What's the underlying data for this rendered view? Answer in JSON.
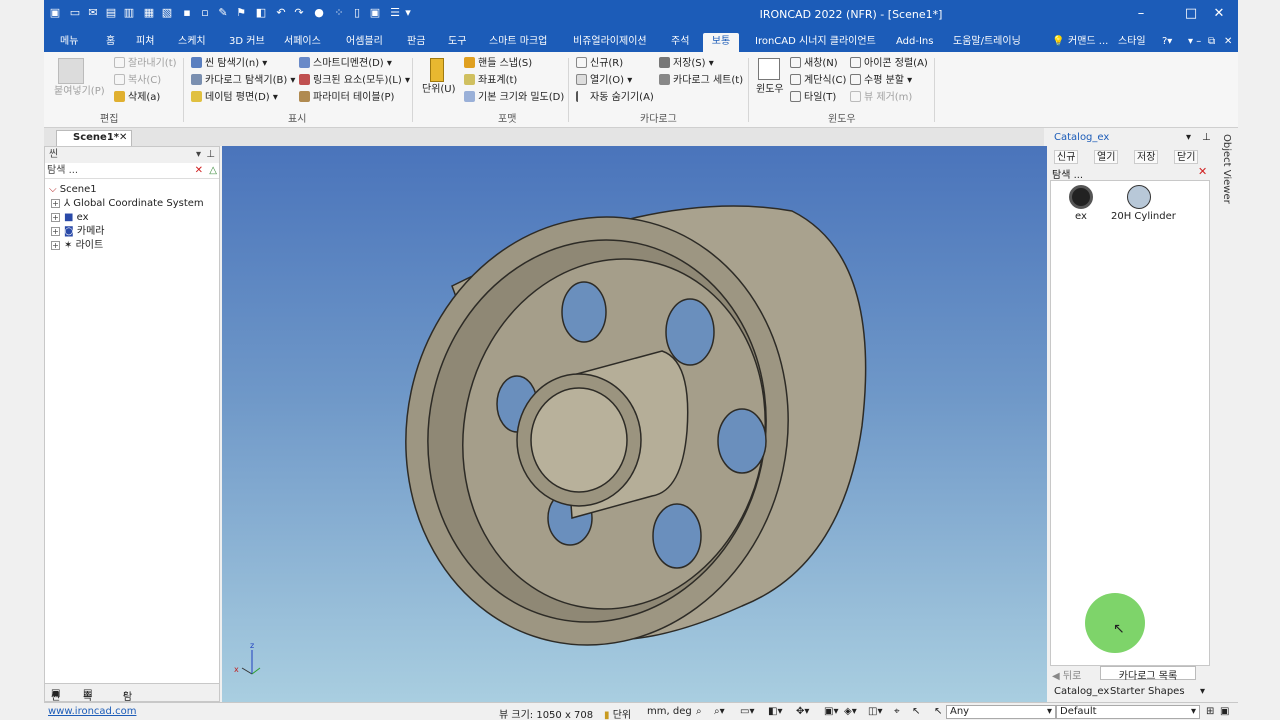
{
  "app": {
    "title": "IRONCAD 2022 (NFR) - [Scene1*]"
  },
  "ribbon_tabs": [
    "메뉴",
    "홈",
    "피쳐",
    "스케치",
    "3D 커브",
    "서페이스",
    "어셈블리",
    "판금",
    "도구",
    "스마트 마크업",
    "비쥬얼라이제이션",
    "주석",
    "보통",
    "IronCAD 시너지 클라이언트",
    "Add-Ins",
    "도움말/트레이닝"
  ],
  "active_tab": "보통",
  "tabs_right": {
    "command": "커맨드 ...",
    "style": "스타일"
  },
  "ribbon": {
    "edit": {
      "paste": "붙여넣기(P)",
      "cut": "잘라내기(t)",
      "copy": "복사(C)",
      "delete": "삭제(a)",
      "group": "편집"
    },
    "display": {
      "scene_browser": "씬 탐색기(n)",
      "catalog_browser": "카다로그 탐색기(B)",
      "datum_plane": "데이텀 평면(D)",
      "smart_dimension": "스마트디멘젼(D)",
      "linked_elements": "링크된 요소(모두)(L)",
      "parameter_table": "파라미터 테이블(P)",
      "group": "표시"
    },
    "format": {
      "units": "단위(U)",
      "handle_snap": "핸들 스냅(S)",
      "coordinates": "좌표계(t)",
      "base_size": "기본 크기와 밀도(D)",
      "group": "포맷"
    },
    "catalog": {
      "new": "신규(R)",
      "open": "열기(O)",
      "auto_hide": "자동 숨기기(A)",
      "save": "저장(S)",
      "catalog_set": "카다로그 세트(t)",
      "group": "카다로그"
    },
    "window": {
      "window": "윈도우",
      "new_window": "새창(N)",
      "cascade": "계단식(C)",
      "tile": "타일(T)",
      "arrange_icons": "아이콘 정렬(A)",
      "split_horizontal": "수평 분할",
      "remove_view": "뷰 제거(m)",
      "group": "윈도우"
    }
  },
  "doc_tab": "Scene1*",
  "scene_panel": {
    "title": "씬",
    "search_placeholder": "탐색 ...",
    "tree": [
      "Scene1",
      "Global Coordinate System",
      "ex",
      "카메라",
      "라이트"
    ],
    "bottom_tabs": [
      "씬",
      "속성",
      "탐색"
    ]
  },
  "catalog_panel": {
    "title": "Catalog_ex",
    "tools": [
      "신규",
      "열기",
      "저장",
      "닫기"
    ],
    "search_placeholder": "탐색 ...",
    "items": [
      "ex",
      "20H Cylinder"
    ],
    "back": "뒤로",
    "catalog_list": "카다로그 목록",
    "tabs": [
      "Catalog_ex",
      "Starter",
      "Shapes"
    ]
  },
  "object_viewer": "Object Viewer",
  "status": {
    "link": "www.ironcad.com",
    "view_size": "뷰 크기: 1050 x  708",
    "units_label": "단위",
    "units": "mm, deg",
    "filter": "Any",
    "style": "Default"
  },
  "colors": {
    "titlebar": "#1c5cb8",
    "viewport_top": "#4a74bb",
    "viewport_bottom": "#a9cee0",
    "part": "#a39c88",
    "cursor_highlight": "#7ed46a"
  }
}
